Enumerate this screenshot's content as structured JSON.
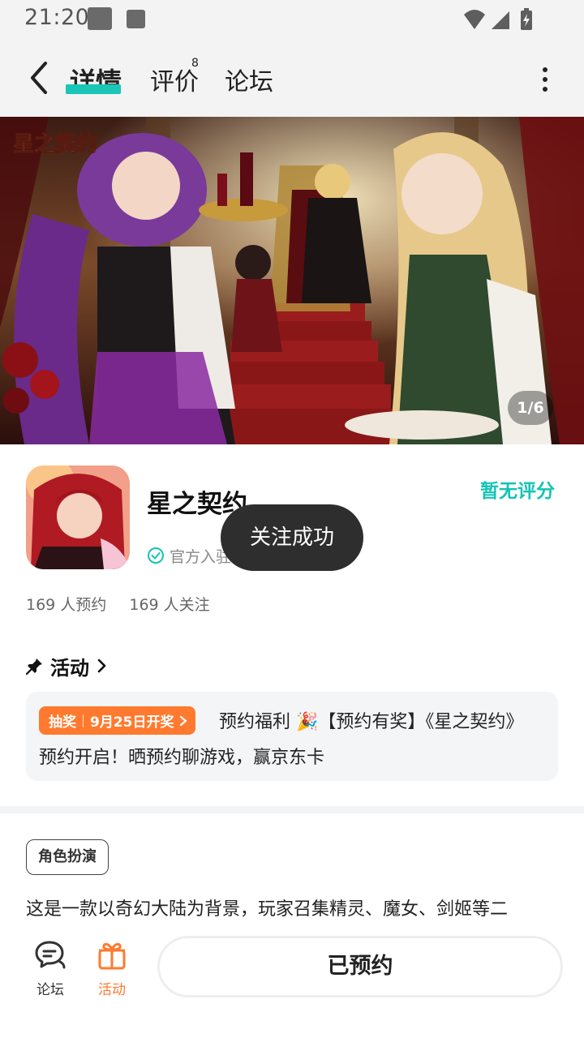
{
  "status_bar": {
    "time": "21:20"
  },
  "header": {
    "tabs": {
      "detail": "详情",
      "review": "评价",
      "review_count": "8",
      "forum": "论坛"
    },
    "accent_color": "#19c6b8"
  },
  "banner": {
    "logo_text": "星之契约",
    "counter": "1/6"
  },
  "game": {
    "title": "星之契约",
    "rating": "暂无评分",
    "official_label": "官方入驻",
    "reservations": "169 人预约",
    "followers": "169 人关注"
  },
  "toast": {
    "message": "关注成功"
  },
  "activity": {
    "section_title": "活动",
    "badge_type": "抽奖",
    "badge_date": "9月25日开奖",
    "text": "预约福利 🎉【预约有奖】《星之契约》预约开启！晒预约聊游戏，赢京东卡"
  },
  "info": {
    "tag": "角色扮演",
    "description": "这是一款以奇幻大陆为背景，玩家召集精灵、魔女、剑姬等二"
  },
  "bottom_bar": {
    "forum_label": "论坛",
    "activity_label": "活动",
    "reserve_button": "已预约",
    "activity_color": "#ff7a2e"
  }
}
